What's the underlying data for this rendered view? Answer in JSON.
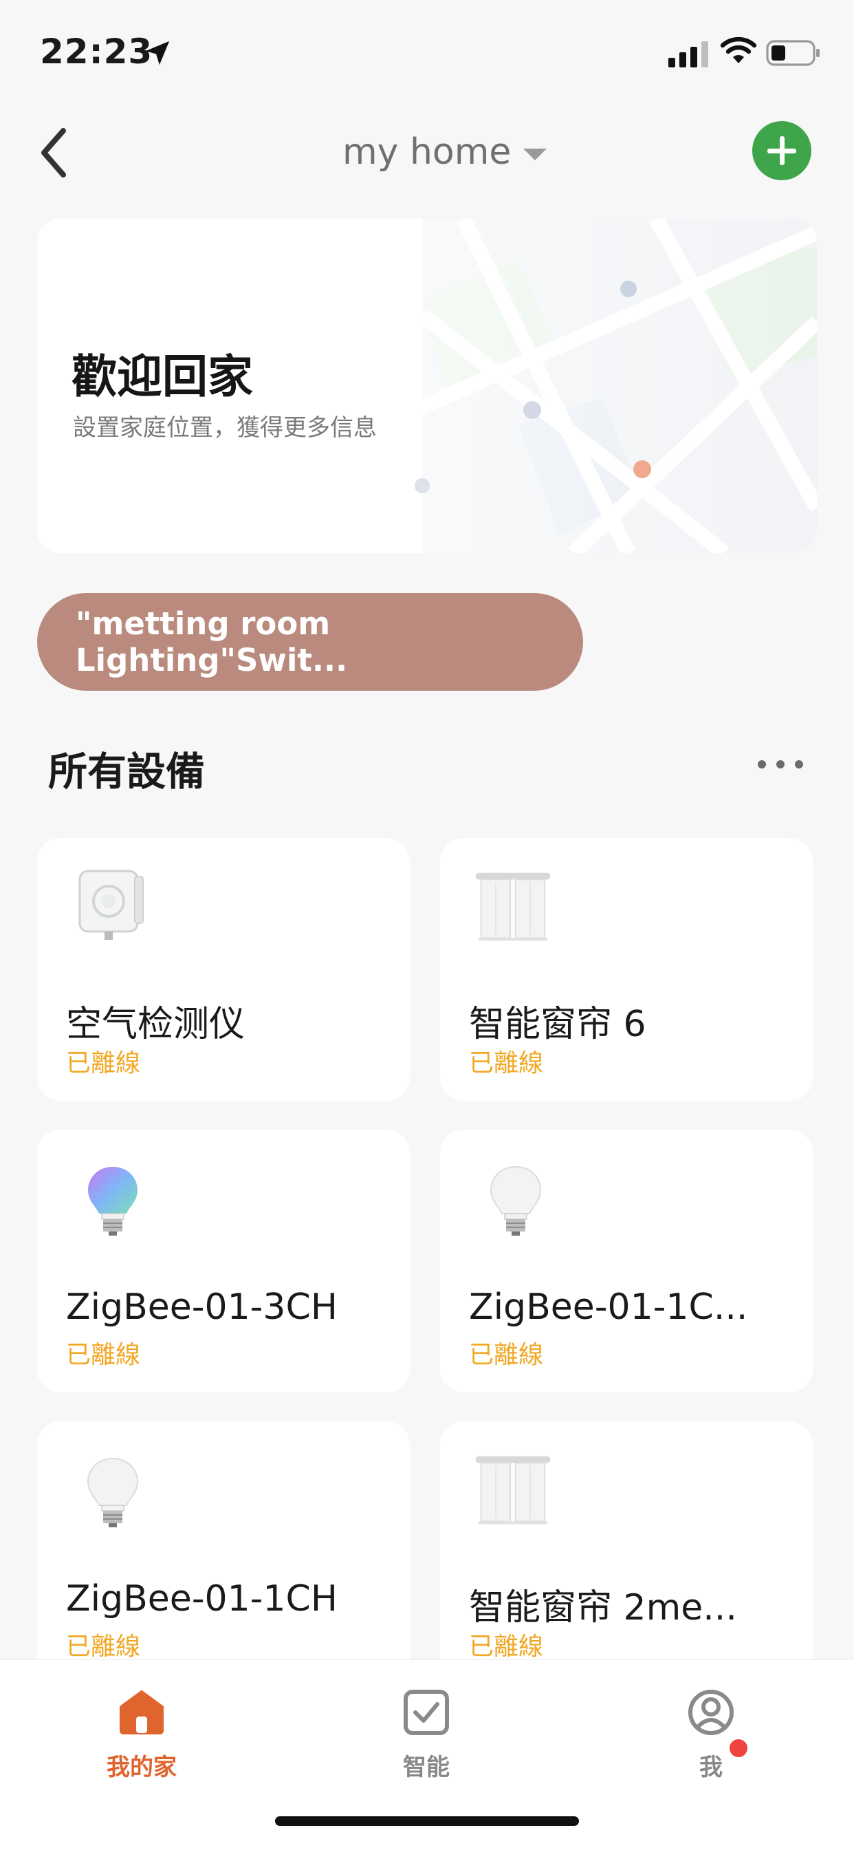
{
  "status_bar": {
    "time": "22:23"
  },
  "header": {
    "home_name": "my home"
  },
  "welcome": {
    "title": "歡迎回家",
    "subtitle": "設置家庭位置，獲得更多信息"
  },
  "scene": {
    "label": "\"metting room Lighting\"Swit..."
  },
  "devices_section": {
    "title": "所有設備"
  },
  "devices": [
    {
      "name": "空气检测仪",
      "status": "已離線",
      "icon": "air-detector-icon"
    },
    {
      "name": "智能窗帘 6",
      "status": "已離線",
      "icon": "curtain-icon"
    },
    {
      "name": "ZigBee-01-3CH",
      "status": "已離線",
      "icon": "rgb-bulb-icon"
    },
    {
      "name": "ZigBee-01-1C...",
      "status": "已離線",
      "icon": "bulb-icon"
    },
    {
      "name": "ZigBee-01-1CH",
      "status": "已離線",
      "icon": "bulb-icon"
    },
    {
      "name": "智能窗帘 2me...",
      "status": "已離線",
      "icon": "curtain-icon"
    }
  ],
  "tabs": [
    {
      "label": "我的家",
      "icon": "home-icon",
      "active": true
    },
    {
      "label": "智能",
      "icon": "smart-checkbox-icon",
      "active": false
    },
    {
      "label": "我",
      "icon": "profile-icon",
      "active": false,
      "badge": true
    }
  ],
  "colors": {
    "accent": "#e0642e",
    "add_button": "#3ea54a",
    "offline": "#f2a825",
    "scene_pill": "#b98a7d"
  }
}
